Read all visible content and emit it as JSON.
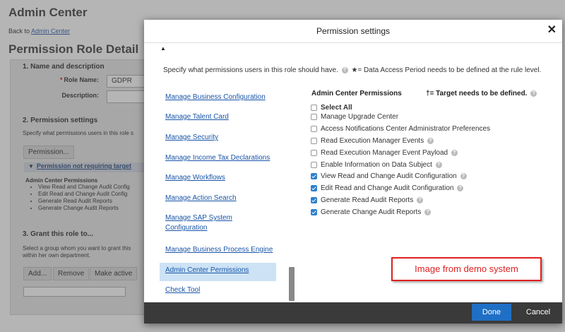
{
  "background": {
    "app_title": "Admin Center",
    "back_prefix": "Back to",
    "back_link": "Admin Center",
    "page_title": "Permission Role Detail",
    "section1": "1. Name and description",
    "role_name_label": "Role Name:",
    "role_name_value": "GDPR",
    "description_label": "Description:",
    "section2": "2. Permission settings",
    "section2_text": "Specify what permissions users in this role s",
    "permission_button": "Permission...",
    "collapsed_header": "Permission not requiring target",
    "summary_heading": "Admin Center Permissions",
    "summary_items": [
      "View Read and Change Audit Config",
      "Edit Read and Change Audit Config",
      "Generate Read Audit Reports",
      "Generate Change Audit Reports"
    ],
    "section3": "3. Grant this role to...",
    "section3_text_1": "Select a group whom you want to grant this",
    "section3_text_2": "within her own department.",
    "add_button": "Add...",
    "remove_button": "Remove",
    "make_active_button": "Make active"
  },
  "modal": {
    "title": "Permission settings",
    "intro_1": "Specify what permissions users in this role should have.",
    "intro_2": "★= Data Access Period needs to be defined at the rule level.",
    "categories": [
      {
        "label": "Manage Business Configuration",
        "selected": false
      },
      {
        "label": "Manage Talent Card",
        "selected": false
      },
      {
        "label": "Manage Security",
        "selected": false
      },
      {
        "label": "Manage Income Tax Declarations",
        "selected": false
      },
      {
        "label": "Manage Workflows",
        "selected": false
      },
      {
        "label": "Manage Action Search",
        "selected": false
      },
      {
        "label": "Manage SAP System Configuration",
        "selected": false
      },
      {
        "label": "Manage Business Process Engine",
        "selected": false
      },
      {
        "label": "Admin Center Permissions",
        "selected": true
      },
      {
        "label": "Check Tool",
        "selected": false
      }
    ],
    "perm_heading": "Admin Center Permissions",
    "target_note": "†= Target needs to be defined.",
    "permissions": [
      {
        "label": "Select All",
        "checked": false,
        "help": false,
        "bold": true
      },
      {
        "label": "Manage Upgrade Center",
        "checked": false,
        "help": false,
        "bold": false
      },
      {
        "label": "Access Notifications Center Administrator Preferences",
        "checked": false,
        "help": false,
        "bold": false
      },
      {
        "label": "Read Execution Manager Events",
        "checked": false,
        "help": true,
        "bold": false
      },
      {
        "label": "Read Execution Manager Event Payload",
        "checked": false,
        "help": true,
        "bold": false
      },
      {
        "label": "Enable Information on Data Subject",
        "checked": false,
        "help": true,
        "bold": false
      },
      {
        "label": "View Read and Change Audit Configuration",
        "checked": true,
        "help": true,
        "bold": false
      },
      {
        "label": "Edit Read and Change Audit Configuration",
        "checked": true,
        "help": true,
        "bold": false
      },
      {
        "label": "Generate Read Audit Reports",
        "checked": true,
        "help": true,
        "bold": false
      },
      {
        "label": "Generate Change Audit Reports",
        "checked": true,
        "help": true,
        "bold": false
      }
    ],
    "watermark": "Image from demo system",
    "done": "Done",
    "cancel": "Cancel"
  }
}
